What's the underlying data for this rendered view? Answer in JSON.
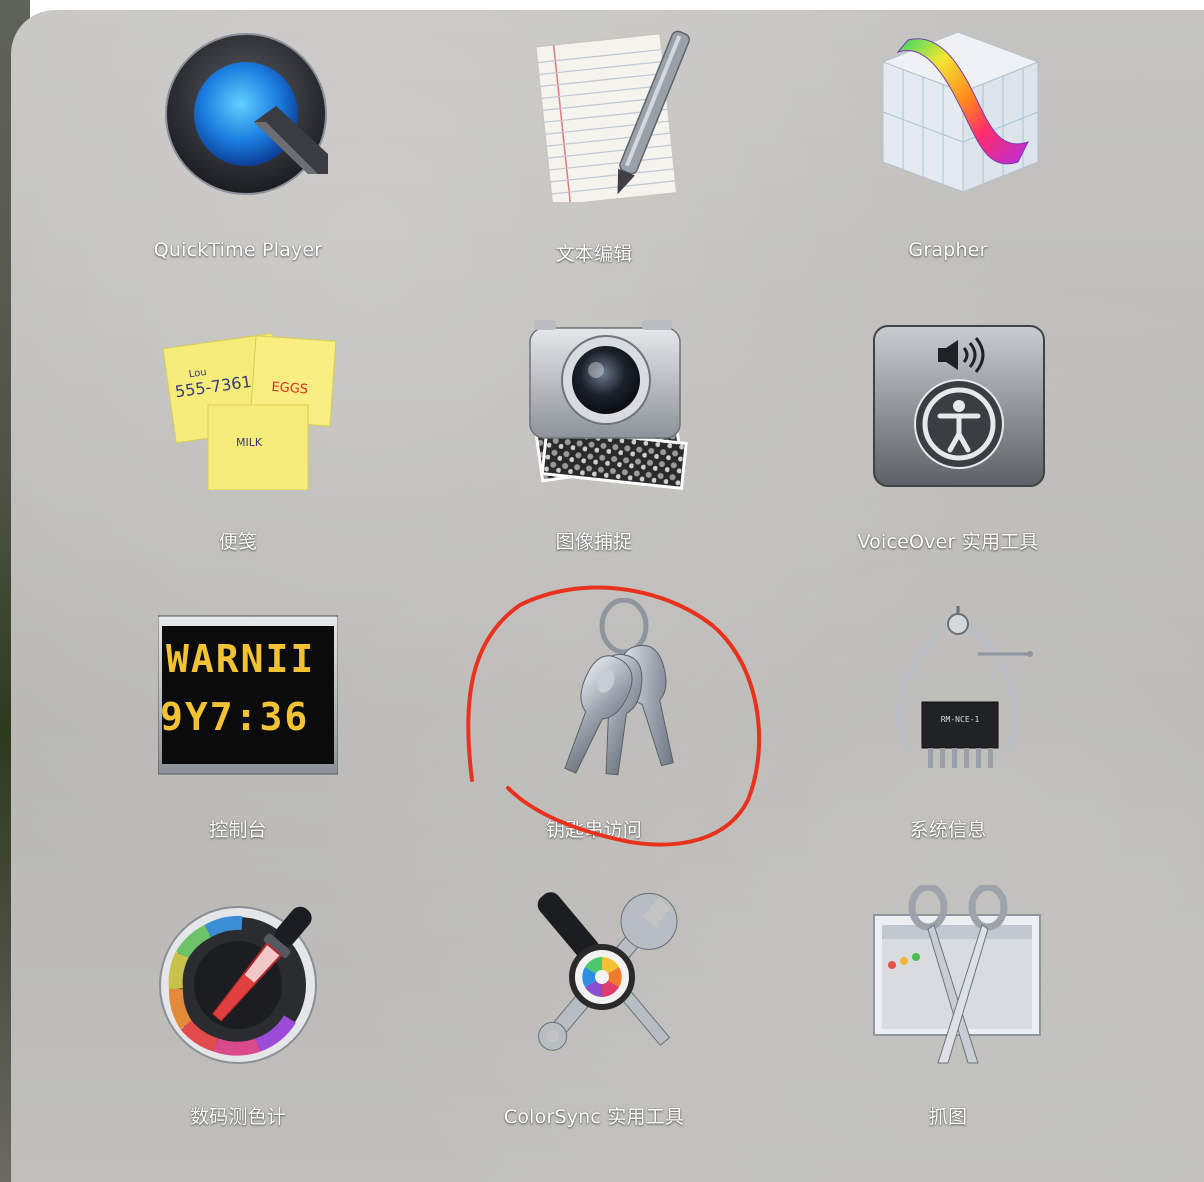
{
  "apps": [
    {
      "id": "quicktime",
      "label": "QuickTime Player",
      "icon": "quicktime-icon"
    },
    {
      "id": "textedit",
      "label": "文本编辑",
      "icon": "textedit-icon"
    },
    {
      "id": "grapher",
      "label": "Grapher",
      "icon": "grapher-icon"
    },
    {
      "id": "stickies",
      "label": "便笺",
      "icon": "stickies-icon",
      "note_text": [
        "Lou",
        "555-7361",
        "EGGS",
        "MILK"
      ]
    },
    {
      "id": "image-capture",
      "label": "图像捕捉",
      "icon": "camera-icon"
    },
    {
      "id": "voiceover",
      "label": "VoiceOver 实用工具",
      "icon": "accessibility-icon"
    },
    {
      "id": "console",
      "label": "控制台",
      "icon": "console-icon",
      "display_text": [
        "WARNII",
        "9Y7:36"
      ]
    },
    {
      "id": "keychain",
      "label": "钥匙串访问",
      "icon": "keys-icon"
    },
    {
      "id": "system-info",
      "label": "系统信息",
      "icon": "caliper-chip-icon",
      "chip_text": "RM-NCE-1"
    },
    {
      "id": "digital-color-meter",
      "label": "数码测色计",
      "icon": "color-dropper-icon"
    },
    {
      "id": "colorsync",
      "label": "ColorSync 实用工具",
      "icon": "colorsync-tools-icon"
    },
    {
      "id": "grab",
      "label": "抓图",
      "icon": "scissors-icon"
    }
  ],
  "annotation": {
    "color": "#e8321e",
    "target": "keychain"
  }
}
